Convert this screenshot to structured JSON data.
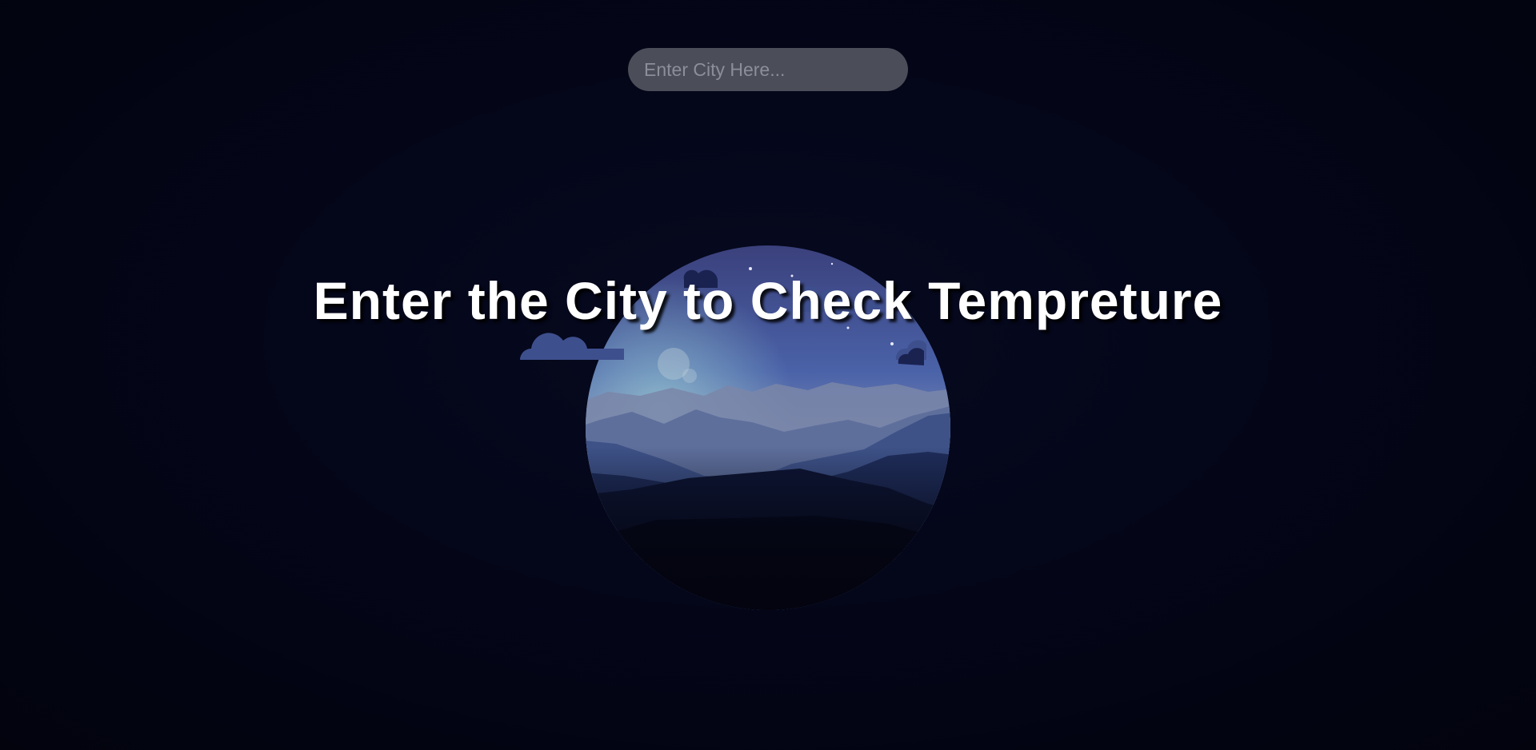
{
  "search": {
    "placeholder": "Enter City Here...",
    "value": ""
  },
  "headline": {
    "text": "Enter the City to Check Tempreture"
  },
  "illustration": {
    "icon": "night-mountain-landscape-icon"
  },
  "colors": {
    "background": "#03040f",
    "input_background": "#4b4d59",
    "input_placeholder": "#8c8e99",
    "headline_text": "#ffffff"
  }
}
